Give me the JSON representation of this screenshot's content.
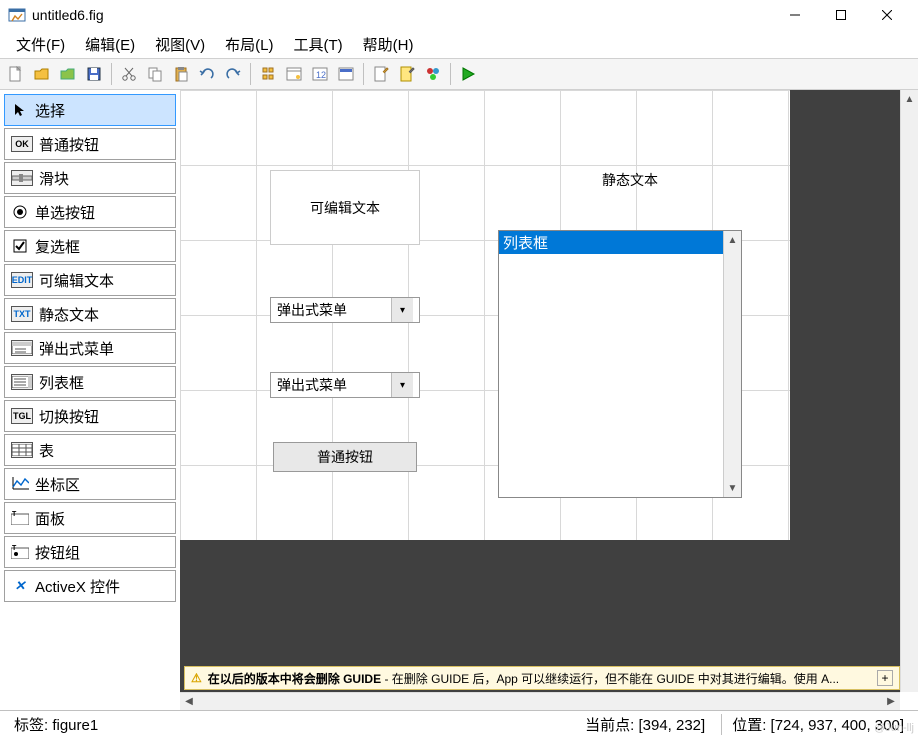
{
  "window": {
    "title": "untitled6.fig"
  },
  "menu": {
    "file": "文件(F)",
    "edit": "编辑(E)",
    "view": "视图(V)",
    "layout": "布局(L)",
    "tools": "工具(T)",
    "help": "帮助(H)"
  },
  "palette": {
    "select": "选择",
    "pushbutton": "普通按钮",
    "slider": "滑块",
    "radio": "单选按钮",
    "checkbox": "复选框",
    "edit": "可编辑文本",
    "static": "静态文本",
    "popup": "弹出式菜单",
    "listbox": "列表框",
    "toggle": "切换按钮",
    "table": "表",
    "axes": "坐标区",
    "panel": "面板",
    "buttongroup": "按钮组",
    "activex": "ActiveX 控件"
  },
  "canvas": {
    "edit_text": "可编辑文本",
    "static_text": "静态文本",
    "popup1": "弹出式菜单",
    "popup2": "弹出式菜单",
    "button": "普通按钮",
    "listbox_item": "列表框"
  },
  "warning": {
    "bold": "在以后的版本中将会删除 GUIDE",
    "rest": " - 在删除 GUIDE 后，App 可以继续运行，但不能在 GUIDE 中对其进行编辑。使用 A..."
  },
  "status": {
    "tag_label": "标签: ",
    "tag_value": "figure1",
    "current_label": "当前点:  ",
    "current_value": "[394, 232]",
    "pos_label": "位置: ",
    "pos_value": "[724, 937, 400, 300]"
  },
  "watermark": "@Jun-llj"
}
